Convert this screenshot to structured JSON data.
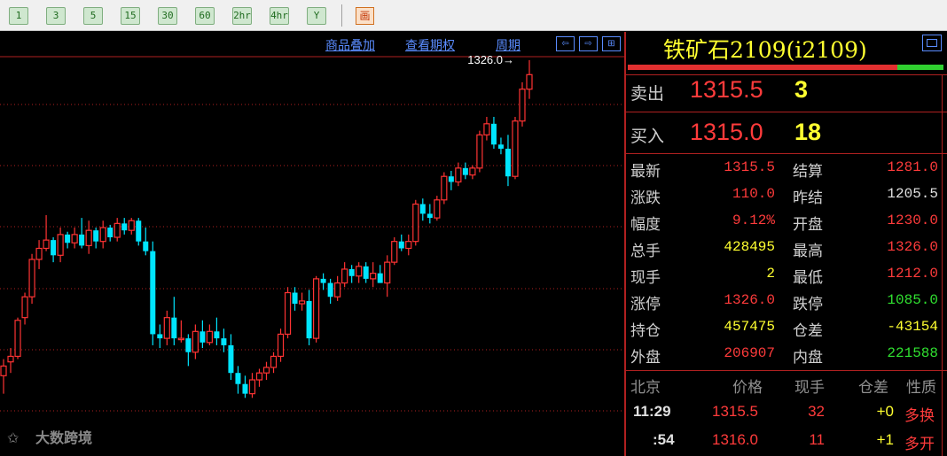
{
  "toolbar": {
    "periods": [
      "1",
      "3",
      "5",
      "15",
      "30",
      "60",
      "2hr",
      "4hr",
      "Y"
    ]
  },
  "chart": {
    "menu": [
      "商品叠加",
      "查看期权",
      "周期"
    ],
    "nav_buttons": [
      "⇦",
      "⇨",
      "⊞"
    ],
    "high_marker": "1326.0→",
    "colors": {
      "up": "#ff3333",
      "down": "#00e5ff",
      "background": "#000000",
      "grid": "#b02020"
    }
  },
  "chart_data": {
    "type": "candlestick",
    "ylim": [
      1040,
      1340
    ],
    "max_annotation": 1326.0,
    "candles": [
      {
        "o": 1098,
        "h": 1110,
        "l": 1085,
        "c": 1105
      },
      {
        "o": 1108,
        "h": 1118,
        "l": 1100,
        "c": 1112
      },
      {
        "o": 1112,
        "h": 1140,
        "l": 1110,
        "c": 1138
      },
      {
        "o": 1140,
        "h": 1158,
        "l": 1135,
        "c": 1155
      },
      {
        "o": 1155,
        "h": 1186,
        "l": 1150,
        "c": 1182
      },
      {
        "o": 1182,
        "h": 1196,
        "l": 1175,
        "c": 1190
      },
      {
        "o": 1190,
        "h": 1214,
        "l": 1188,
        "c": 1196
      },
      {
        "o": 1196,
        "h": 1198,
        "l": 1180,
        "c": 1185
      },
      {
        "o": 1185,
        "h": 1205,
        "l": 1180,
        "c": 1200
      },
      {
        "o": 1200,
        "h": 1202,
        "l": 1190,
        "c": 1194
      },
      {
        "o": 1194,
        "h": 1205,
        "l": 1190,
        "c": 1200
      },
      {
        "o": 1200,
        "h": 1212,
        "l": 1190,
        "c": 1192
      },
      {
        "o": 1192,
        "h": 1210,
        "l": 1186,
        "c": 1203
      },
      {
        "o": 1203,
        "h": 1205,
        "l": 1190,
        "c": 1195
      },
      {
        "o": 1195,
        "h": 1210,
        "l": 1190,
        "c": 1205
      },
      {
        "o": 1205,
        "h": 1207,
        "l": 1195,
        "c": 1198
      },
      {
        "o": 1198,
        "h": 1212,
        "l": 1195,
        "c": 1208
      },
      {
        "o": 1208,
        "h": 1212,
        "l": 1200,
        "c": 1203
      },
      {
        "o": 1203,
        "h": 1212,
        "l": 1200,
        "c": 1210
      },
      {
        "o": 1210,
        "h": 1212,
        "l": 1192,
        "c": 1195
      },
      {
        "o": 1195,
        "h": 1205,
        "l": 1185,
        "c": 1188
      },
      {
        "o": 1188,
        "h": 1195,
        "l": 1120,
        "c": 1128
      },
      {
        "o": 1128,
        "h": 1135,
        "l": 1118,
        "c": 1125
      },
      {
        "o": 1125,
        "h": 1145,
        "l": 1120,
        "c": 1140
      },
      {
        "o": 1140,
        "h": 1155,
        "l": 1120,
        "c": 1125
      },
      {
        "o": 1125,
        "h": 1138,
        "l": 1122,
        "c": 1125
      },
      {
        "o": 1125,
        "h": 1128,
        "l": 1105,
        "c": 1115
      },
      {
        "o": 1115,
        "h": 1135,
        "l": 1110,
        "c": 1130
      },
      {
        "o": 1130,
        "h": 1138,
        "l": 1118,
        "c": 1122
      },
      {
        "o": 1122,
        "h": 1135,
        "l": 1120,
        "c": 1130
      },
      {
        "o": 1130,
        "h": 1140,
        "l": 1120,
        "c": 1125
      },
      {
        "o": 1125,
        "h": 1132,
        "l": 1115,
        "c": 1120
      },
      {
        "o": 1120,
        "h": 1128,
        "l": 1095,
        "c": 1100
      },
      {
        "o": 1100,
        "h": 1105,
        "l": 1085,
        "c": 1092
      },
      {
        "o": 1092,
        "h": 1098,
        "l": 1082,
        "c": 1085
      },
      {
        "o": 1085,
        "h": 1100,
        "l": 1082,
        "c": 1095
      },
      {
        "o": 1095,
        "h": 1103,
        "l": 1090,
        "c": 1100
      },
      {
        "o": 1100,
        "h": 1108,
        "l": 1095,
        "c": 1104
      },
      {
        "o": 1104,
        "h": 1115,
        "l": 1100,
        "c": 1112
      },
      {
        "o": 1112,
        "h": 1132,
        "l": 1108,
        "c": 1128
      },
      {
        "o": 1128,
        "h": 1162,
        "l": 1125,
        "c": 1158
      },
      {
        "o": 1158,
        "h": 1162,
        "l": 1145,
        "c": 1150
      },
      {
        "o": 1150,
        "h": 1158,
        "l": 1145,
        "c": 1152
      },
      {
        "o": 1152,
        "h": 1160,
        "l": 1120,
        "c": 1125
      },
      {
        "o": 1125,
        "h": 1170,
        "l": 1122,
        "c": 1168
      },
      {
        "o": 1168,
        "h": 1172,
        "l": 1160,
        "c": 1165
      },
      {
        "o": 1165,
        "h": 1168,
        "l": 1150,
        "c": 1155
      },
      {
        "o": 1155,
        "h": 1170,
        "l": 1152,
        "c": 1165
      },
      {
        "o": 1165,
        "h": 1180,
        "l": 1162,
        "c": 1175
      },
      {
        "o": 1175,
        "h": 1178,
        "l": 1165,
        "c": 1170
      },
      {
        "o": 1170,
        "h": 1180,
        "l": 1165,
        "c": 1177
      },
      {
        "o": 1177,
        "h": 1180,
        "l": 1165,
        "c": 1168
      },
      {
        "o": 1168,
        "h": 1180,
        "l": 1162,
        "c": 1172
      },
      {
        "o": 1172,
        "h": 1178,
        "l": 1165,
        "c": 1165
      },
      {
        "o": 1165,
        "h": 1185,
        "l": 1155,
        "c": 1180
      },
      {
        "o": 1180,
        "h": 1198,
        "l": 1178,
        "c": 1195
      },
      {
        "o": 1195,
        "h": 1200,
        "l": 1188,
        "c": 1190
      },
      {
        "o": 1190,
        "h": 1200,
        "l": 1185,
        "c": 1195
      },
      {
        "o": 1195,
        "h": 1225,
        "l": 1192,
        "c": 1222
      },
      {
        "o": 1222,
        "h": 1226,
        "l": 1210,
        "c": 1215
      },
      {
        "o": 1215,
        "h": 1222,
        "l": 1208,
        "c": 1212
      },
      {
        "o": 1212,
        "h": 1228,
        "l": 1210,
        "c": 1225
      },
      {
        "o": 1225,
        "h": 1245,
        "l": 1222,
        "c": 1242
      },
      {
        "o": 1242,
        "h": 1246,
        "l": 1232,
        "c": 1238
      },
      {
        "o": 1238,
        "h": 1252,
        "l": 1235,
        "c": 1248
      },
      {
        "o": 1248,
        "h": 1252,
        "l": 1240,
        "c": 1243
      },
      {
        "o": 1243,
        "h": 1250,
        "l": 1240,
        "c": 1248
      },
      {
        "o": 1248,
        "h": 1275,
        "l": 1245,
        "c": 1272
      },
      {
        "o": 1272,
        "h": 1285,
        "l": 1268,
        "c": 1280
      },
      {
        "o": 1280,
        "h": 1285,
        "l": 1262,
        "c": 1265
      },
      {
        "o": 1265,
        "h": 1270,
        "l": 1258,
        "c": 1262
      },
      {
        "o": 1262,
        "h": 1272,
        "l": 1235,
        "c": 1242
      },
      {
        "o": 1242,
        "h": 1285,
        "l": 1240,
        "c": 1282
      },
      {
        "o": 1282,
        "h": 1310,
        "l": 1278,
        "c": 1305
      },
      {
        "o": 1305,
        "h": 1326,
        "l": 1298,
        "c": 1315.5
      }
    ]
  },
  "panel": {
    "symbol": "铁矿石2109(i2109)",
    "order_book": [
      {
        "label": "卖出",
        "price": "1315.5",
        "volume": "3"
      },
      {
        "label": "买入",
        "price": "1315.0",
        "volume": "18"
      }
    ],
    "quotes": [
      {
        "l1": "最新",
        "v1": "1315.5",
        "c1": "#ff3b3b",
        "l2": "结算",
        "v2": "1281.0",
        "c2": "#ff3b3b"
      },
      {
        "l1": "涨跌",
        "v1": "110.0",
        "c1": "#ff3b3b",
        "l2": "昨结",
        "v2": "1205.5",
        "c2": "#e0e0e0"
      },
      {
        "l1": "幅度",
        "v1": "9.12%",
        "c1": "#ff3b3b",
        "l2": "开盘",
        "v2": "1230.0",
        "c2": "#ff3b3b"
      },
      {
        "l1": "总手",
        "v1": "428495",
        "c1": "#ffff30",
        "l2": "最高",
        "v2": "1326.0",
        "c2": "#ff3b3b"
      },
      {
        "l1": "现手",
        "v1": "2",
        "c1": "#ffff30",
        "l2": "最低",
        "v2": "1212.0",
        "c2": "#ff3b3b"
      },
      {
        "l1": "涨停",
        "v1": "1326.0",
        "c1": "#ff3b3b",
        "l2": "跌停",
        "v2": "1085.0",
        "c2": "#30e030"
      },
      {
        "l1": "持仓",
        "v1": "457475",
        "c1": "#ffff30",
        "l2": "仓差",
        "v2": "-43154",
        "c2": "#ffff30"
      },
      {
        "l1": "外盘",
        "v1": "206907",
        "c1": "#ff3b3b",
        "l2": "内盘",
        "v2": "221588",
        "c2": "#30e030"
      }
    ],
    "ticks_header": [
      "北京",
      "价格",
      "现手",
      "仓差",
      "性质"
    ],
    "ticks": [
      {
        "time": "11:29",
        "price": "1315.5",
        "vol": "32",
        "oi": "+0",
        "nature": "多换"
      },
      {
        "time": ":54",
        "price": "1316.0",
        "vol": "11",
        "oi": "+1",
        "nature": "多开"
      }
    ]
  },
  "watermark": "大数跨境"
}
